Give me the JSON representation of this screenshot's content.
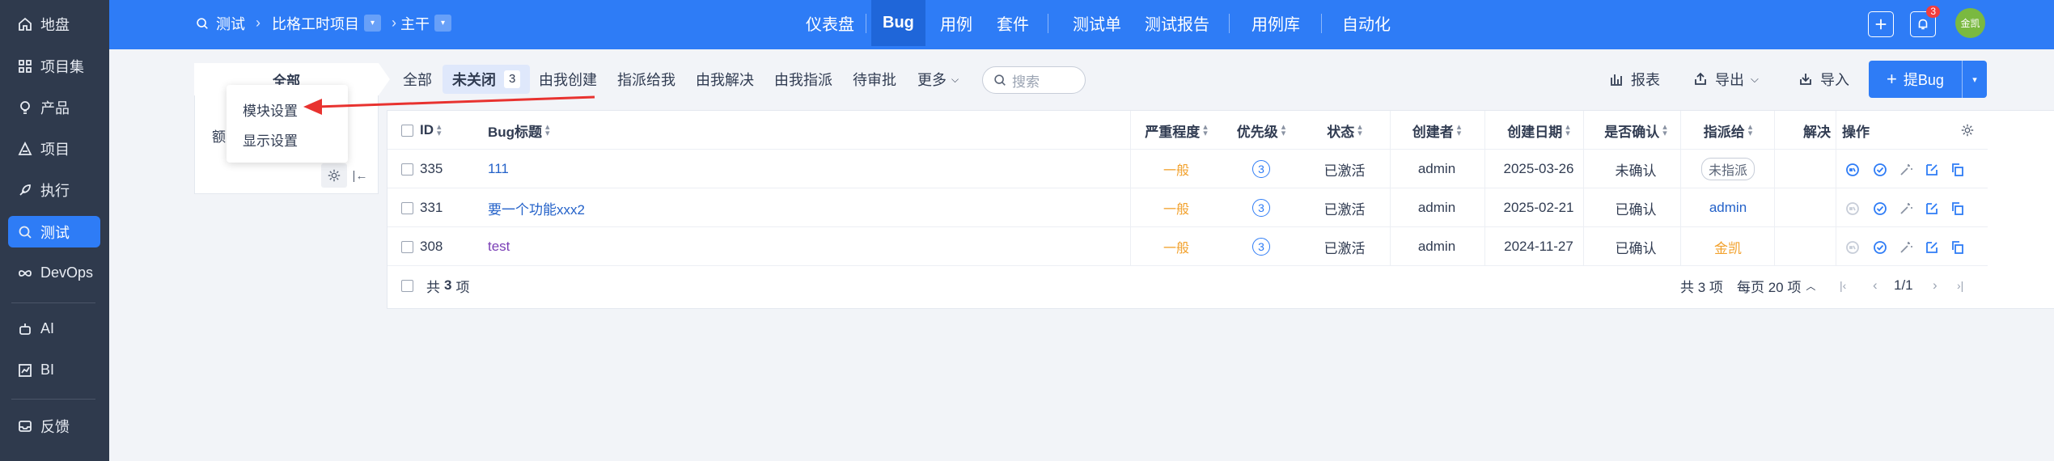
{
  "sidebar": {
    "items": [
      {
        "label": "地盘",
        "icon": "home-icon"
      },
      {
        "label": "项目集",
        "icon": "grid-icon"
      },
      {
        "label": "产品",
        "icon": "lightbulb-icon"
      },
      {
        "label": "项目",
        "icon": "triangle-icon"
      },
      {
        "label": "执行",
        "icon": "rocket-icon"
      },
      {
        "label": "测试",
        "icon": "search-icon",
        "active": true
      },
      {
        "label": "DevOps",
        "icon": "infinity-icon"
      },
      {
        "label": "AI",
        "icon": "robot-icon"
      },
      {
        "label": "BI",
        "icon": "chart-icon"
      },
      {
        "label": "反馈",
        "icon": "inbox-icon"
      }
    ]
  },
  "topbar": {
    "breadcrumb": [
      "测试",
      "比格工时项目",
      "主干"
    ],
    "nav": [
      "仪表盘",
      "Bug",
      "用例",
      "套件",
      "测试单",
      "测试报告",
      "用例库",
      "自动化"
    ],
    "active_nav": "Bug",
    "notification_count": "3",
    "avatar_text": "金凯"
  },
  "module_panel": {
    "tab": "全部",
    "text": "额",
    "menu": [
      "模块设置",
      "显示设置"
    ]
  },
  "filters": {
    "tabs": [
      "全部",
      "未关闭",
      "由我创建",
      "指派给我",
      "由我解决",
      "由我指派",
      "待审批",
      "更多"
    ],
    "active": "未关闭",
    "active_count": "3",
    "search_placeholder": "搜索"
  },
  "actions": {
    "report": "报表",
    "export": "导出",
    "import": "导入",
    "create_bug": "提Bug"
  },
  "table": {
    "headers": {
      "id": "ID",
      "title": "Bug标题",
      "severity": "严重程度",
      "priority": "优先级",
      "status": "状态",
      "creator": "创建者",
      "created_date": "创建日期",
      "confirmed": "是否确认",
      "assigned": "指派给",
      "resolved": "解决",
      "ops": "操作"
    },
    "rows": [
      {
        "id": "335",
        "title": "111",
        "severity": "一般",
        "priority": "3",
        "status": "已激活",
        "creator": "admin",
        "date": "2025-03-26",
        "confirmed": "未确认",
        "assigned": "未指派"
      },
      {
        "id": "331",
        "title": "要一个功能xxx2",
        "severity": "一般",
        "priority": "3",
        "status": "已激活",
        "creator": "admin",
        "date": "2025-02-21",
        "confirmed": "已确认",
        "assigned": "admin"
      },
      {
        "id": "308",
        "title": "test",
        "severity": "一般",
        "priority": "3",
        "status": "已激活",
        "creator": "admin",
        "date": "2024-11-27",
        "confirmed": "已确认",
        "assigned": "金凯"
      }
    ],
    "footer": {
      "total_left_prefix": "共",
      "total_left_count": "3",
      "total_left_suffix": "项",
      "total_right": "共 3 项",
      "per_page": "每页 20 项",
      "pages": "1/1"
    }
  },
  "colors": {
    "brand": "#2e7cf6",
    "sidebar_bg": "#2f3a4d",
    "severity": "#f2a12c",
    "annotation_arrow": "#e8322f"
  }
}
